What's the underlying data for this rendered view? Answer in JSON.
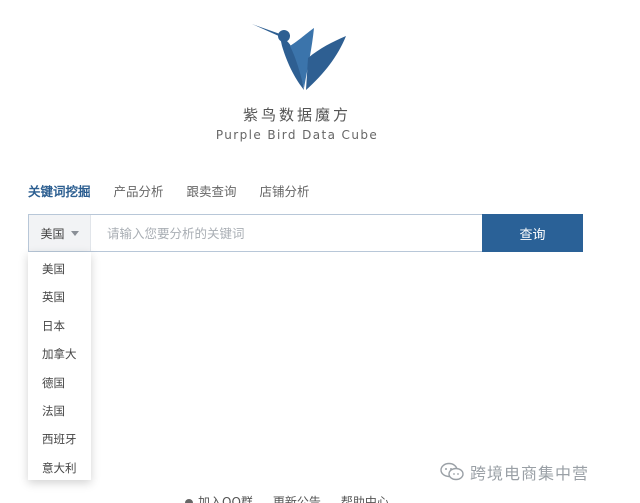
{
  "brand": {
    "name_cn": "紫鸟数据魔方",
    "name_en": "Purple Bird Data Cube"
  },
  "tabs": [
    {
      "label": "关键词挖掘",
      "active": true
    },
    {
      "label": "产品分析",
      "active": false
    },
    {
      "label": "跟卖查询",
      "active": false
    },
    {
      "label": "店铺分析",
      "active": false
    }
  ],
  "search": {
    "country_selected": "美国",
    "placeholder": "请输入您要分析的关键词",
    "value": "",
    "button_label": "查询"
  },
  "country_options": [
    "美国",
    "英国",
    "日本",
    "加拿大",
    "德国",
    "法国",
    "西班牙",
    "意大利"
  ],
  "footer": {
    "links": [
      "加入QQ群",
      "更新公告",
      "帮助中心"
    ]
  },
  "watermark": {
    "text": "跨境电商集中营"
  },
  "colors": {
    "accent": "#2a6197",
    "active_tab": "#2d5f91",
    "logo": "#2e5f92"
  },
  "icons": {
    "logo": "hummingbird-logo",
    "dropdown": "caret-down-icon",
    "watermark": "wechat-icon"
  }
}
